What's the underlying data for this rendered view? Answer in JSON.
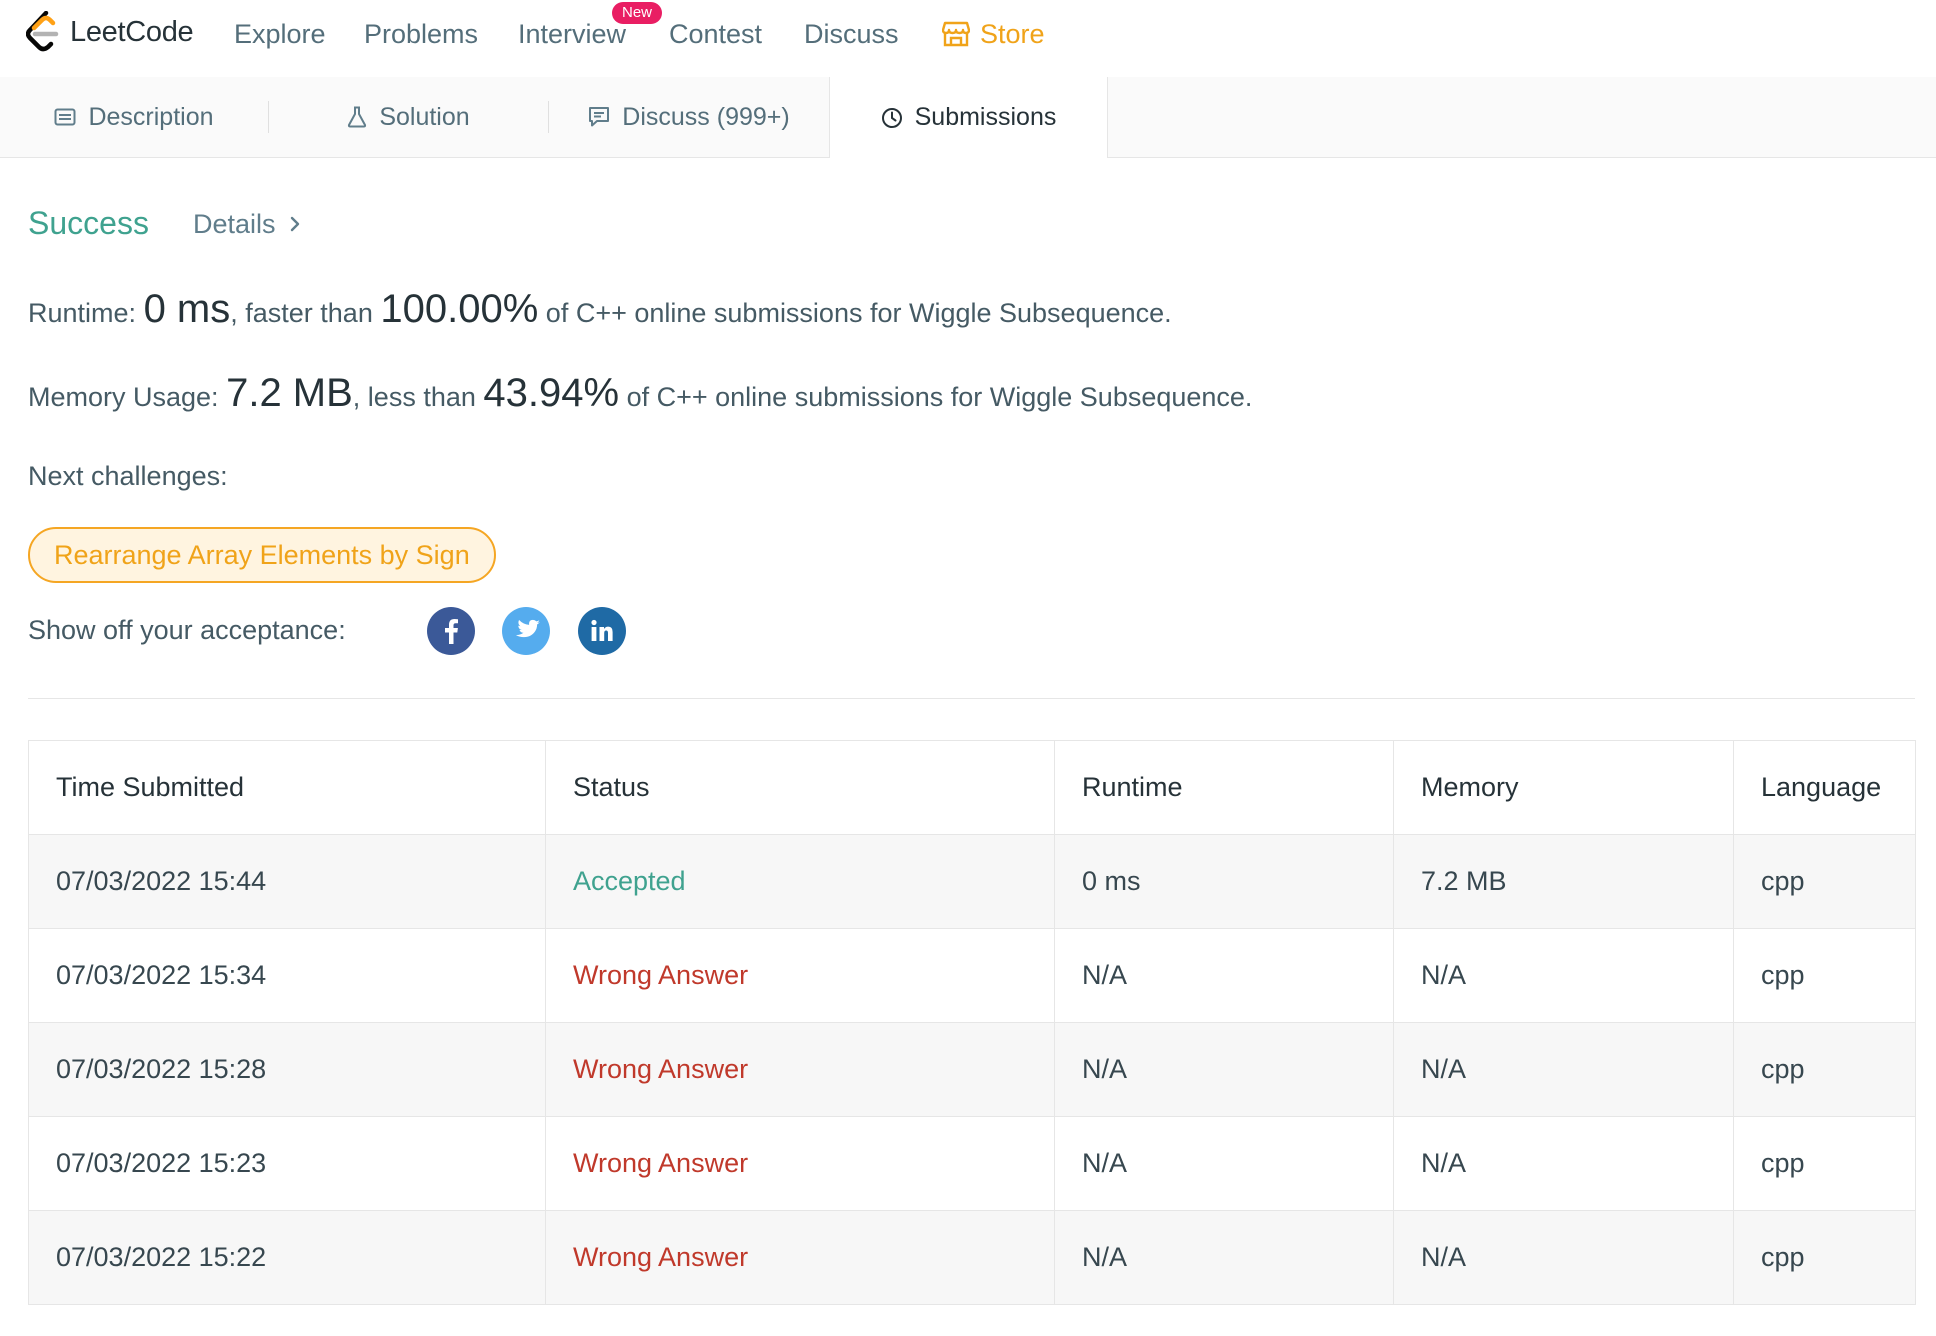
{
  "nav": {
    "logo_text": "LeetCode",
    "items": [
      {
        "label": "Explore"
      },
      {
        "label": "Problems"
      },
      {
        "label": "Interview",
        "badge": "New"
      },
      {
        "label": "Contest"
      },
      {
        "label": "Discuss"
      },
      {
        "label": "Store"
      }
    ],
    "store_color": "#f0a319"
  },
  "tabs": [
    {
      "label": "Description",
      "icon": "description-icon"
    },
    {
      "label": "Solution",
      "icon": "flask-icon"
    },
    {
      "label": "Discuss (999+)",
      "icon": "comment-icon"
    },
    {
      "label": "Submissions",
      "icon": "clock-icon",
      "active": true
    }
  ],
  "result": {
    "status": "Success",
    "status_color": "#3fa28f",
    "details_label": "Details",
    "runtime": {
      "label": "Runtime:",
      "value": "0 ms",
      "mid": ", faster than",
      "percent": "100.00%",
      "tail": "of C++ online submissions for Wiggle Subsequence."
    },
    "memory": {
      "label": "Memory Usage:",
      "value": "7.2 MB",
      "mid": ", less than",
      "percent": "43.94%",
      "tail": "of C++ online submissions for Wiggle Subsequence."
    },
    "next_label": "Next challenges:",
    "next_challenge": "Rearrange Array Elements by Sign",
    "share_label": "Show off your acceptance:",
    "share": [
      {
        "icon": "facebook-icon",
        "color": "#3b5998"
      },
      {
        "icon": "twitter-icon",
        "color": "#55acee"
      },
      {
        "icon": "linkedin-icon",
        "color": "#1f6aa5"
      }
    ]
  },
  "table": {
    "headers": [
      "Time Submitted",
      "Status",
      "Runtime",
      "Memory",
      "Language"
    ],
    "rows": [
      {
        "time": "07/03/2022 15:44",
        "status": "Accepted",
        "runtime": "0 ms",
        "memory": "7.2 MB",
        "language": "cpp"
      },
      {
        "time": "07/03/2022 15:34",
        "status": "Wrong Answer",
        "runtime": "N/A",
        "memory": "N/A",
        "language": "cpp"
      },
      {
        "time": "07/03/2022 15:28",
        "status": "Wrong Answer",
        "runtime": "N/A",
        "memory": "N/A",
        "language": "cpp"
      },
      {
        "time": "07/03/2022 15:23",
        "status": "Wrong Answer",
        "runtime": "N/A",
        "memory": "N/A",
        "language": "cpp"
      },
      {
        "time": "07/03/2022 15:22",
        "status": "Wrong Answer",
        "runtime": "N/A",
        "memory": "N/A",
        "language": "cpp"
      }
    ],
    "accepted_color": "#3fa28f",
    "wrong_color": "#c0392b"
  }
}
